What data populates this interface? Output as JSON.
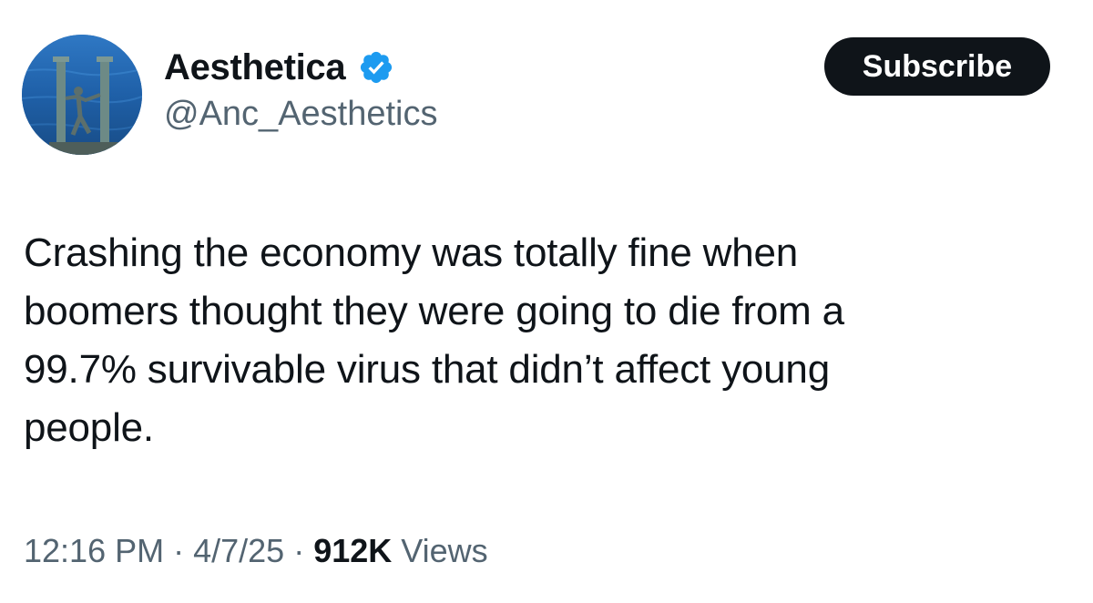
{
  "author": {
    "display_name": "Aesthetica",
    "handle": "@Anc_Aesthetics",
    "verified": true,
    "avatar_icon": "statue-between-columns-avatar"
  },
  "actions": {
    "subscribe_label": "Subscribe"
  },
  "tweet": {
    "text": "Crashing the economy was totally fine when\nboomers thought they were going to die from a\n99.7% survivable virus that didn’t affect young\npeople."
  },
  "meta": {
    "time": "12:16 PM",
    "separator": "·",
    "date": "4/7/25",
    "views_count": "912K",
    "views_label": "Views"
  },
  "colors": {
    "text_primary": "#0f1419",
    "text_secondary": "#536471",
    "verified_blue": "#1d9bf0",
    "button_bg": "#0f1419"
  }
}
